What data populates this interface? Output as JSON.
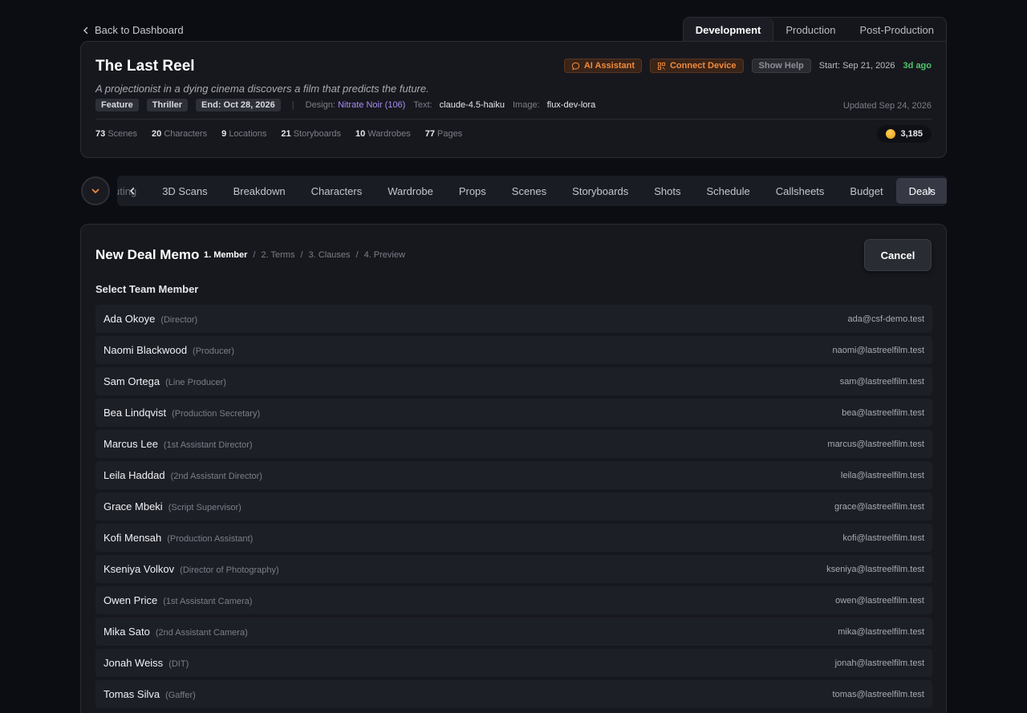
{
  "back_link": "Back to Dashboard",
  "phase_tabs": [
    "Development",
    "Production",
    "Post-Production"
  ],
  "project": {
    "title": "The Last Reel",
    "logline": "A projectionist in a dying cinema discovers a film that predicts the future.",
    "actions": {
      "ai_assistant": "AI Assistant",
      "connect_device": "Connect Device",
      "show_help": "Show Help"
    },
    "start": "Start: Sep 21, 2026",
    "ago": "3d ago",
    "tags": [
      "Feature",
      "Thriller",
      "End: Oct 28, 2026"
    ],
    "design_label": "Design:",
    "design_value": "Nitrate Noir (106)",
    "text_label": "Text:",
    "text_value": "claude-4.5-haiku",
    "image_label": "Image:",
    "image_value": "flux-dev-lora",
    "updated": "Updated Sep 24, 2026",
    "stats": [
      {
        "num": "73",
        "label": "Scenes"
      },
      {
        "num": "20",
        "label": "Characters"
      },
      {
        "num": "9",
        "label": "Locations"
      },
      {
        "num": "21",
        "label": "Storyboards"
      },
      {
        "num": "10",
        "label": "Wardrobes"
      },
      {
        "num": "77",
        "label": "Pages"
      }
    ],
    "credits": "3,185"
  },
  "nav": {
    "partial": "uting",
    "items": [
      "3D Scans",
      "Breakdown",
      "Characters",
      "Wardrobe",
      "Props",
      "Scenes",
      "Storyboards",
      "Shots",
      "Schedule",
      "Callsheets",
      "Budget",
      "Deals"
    ],
    "active": "Deals"
  },
  "deal_memo": {
    "title": "New Deal Memo",
    "steps": [
      "1. Member",
      "2. Terms",
      "3. Clauses",
      "4. Preview"
    ],
    "step_separator": "/",
    "cancel": "Cancel",
    "section_label": "Select Team Member",
    "members": [
      {
        "name": "Ada Okoye",
        "role": "(Director)",
        "email": "ada@csf-demo.test"
      },
      {
        "name": "Naomi Blackwood",
        "role": "(Producer)",
        "email": "naomi@lastreelfilm.test"
      },
      {
        "name": "Sam Ortega",
        "role": "(Line Producer)",
        "email": "sam@lastreelfilm.test"
      },
      {
        "name": "Bea Lindqvist",
        "role": "(Production Secretary)",
        "email": "bea@lastreelfilm.test"
      },
      {
        "name": "Marcus Lee",
        "role": "(1st Assistant Director)",
        "email": "marcus@lastreelfilm.test"
      },
      {
        "name": "Leila Haddad",
        "role": "(2nd Assistant Director)",
        "email": "leila@lastreelfilm.test"
      },
      {
        "name": "Grace Mbeki",
        "role": "(Script Supervisor)",
        "email": "grace@lastreelfilm.test"
      },
      {
        "name": "Kofi Mensah",
        "role": "(Production Assistant)",
        "email": "kofi@lastreelfilm.test"
      },
      {
        "name": "Kseniya Volkov",
        "role": "(Director of Photography)",
        "email": "kseniya@lastreelfilm.test"
      },
      {
        "name": "Owen Price",
        "role": "(1st Assistant Camera)",
        "email": "owen@lastreelfilm.test"
      },
      {
        "name": "Mika Sato",
        "role": "(2nd Assistant Camera)",
        "email": "mika@lastreelfilm.test"
      },
      {
        "name": "Jonah Weiss",
        "role": "(DIT)",
        "email": "jonah@lastreelfilm.test"
      },
      {
        "name": "Tomas Silva",
        "role": "(Gaffer)",
        "email": "tomas@lastreelfilm.test"
      }
    ]
  },
  "colors": {
    "accent_orange": "#f08a3c",
    "accent_green": "#4fc46a",
    "accent_purple": "#a98bf0"
  }
}
